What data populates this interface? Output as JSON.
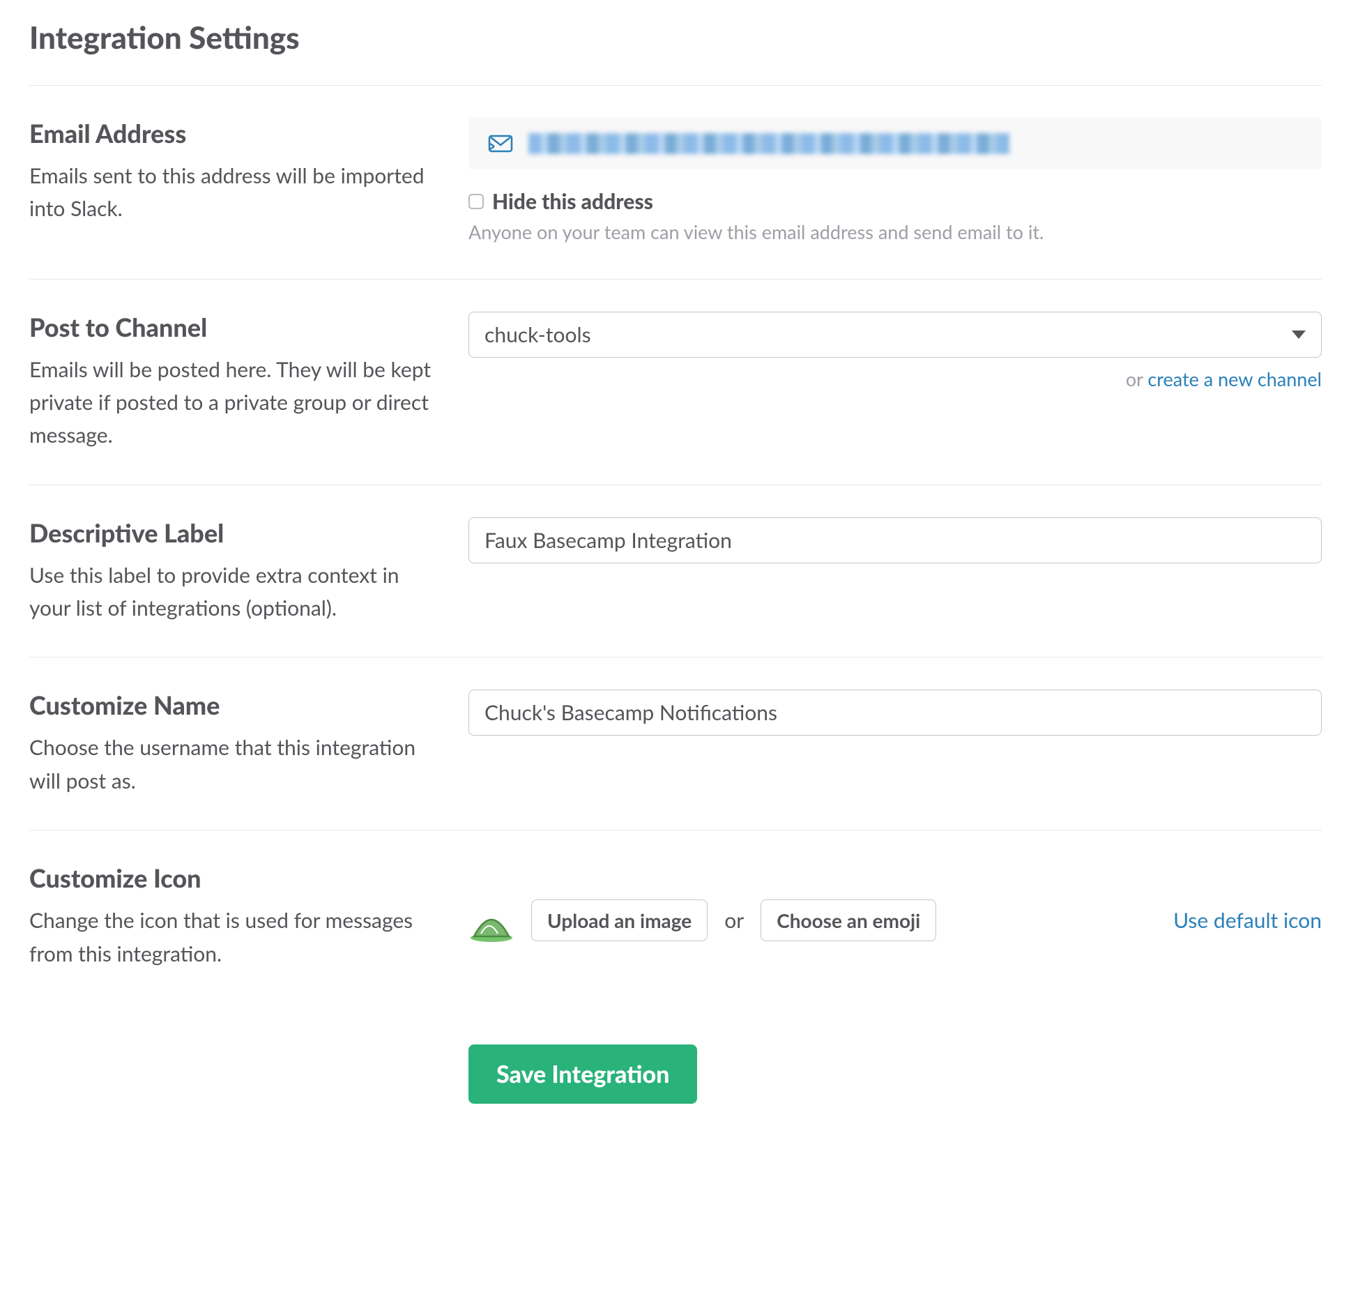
{
  "page_title": "Integration Settings",
  "sections": {
    "email": {
      "heading": "Email Address",
      "desc": "Emails sent to this address will be imported into Slack.",
      "hide_checkbox_label": "Hide this address",
      "hide_subtext": "Anyone on your team can view this email address and send email to it."
    },
    "channel": {
      "heading": "Post to Channel",
      "desc": "Emails will be posted here. They will be kept private if posted to a private group or direct message.",
      "selected": "chuck-tools",
      "helper_or": "or ",
      "helper_link": "create a new channel"
    },
    "label": {
      "heading": "Descriptive Label",
      "desc": "Use this label to provide extra context in your list of integrations (optional).",
      "value": "Faux Basecamp Integration"
    },
    "name": {
      "heading": "Customize Name",
      "desc": "Choose the username that this integration will post as.",
      "value": "Chuck's Basecamp Notifications"
    },
    "icon": {
      "heading": "Customize Icon",
      "desc": "Change the icon that is used for messages from this integration.",
      "upload_label": "Upload an image",
      "or_label": "or",
      "emoji_label": "Choose an emoji",
      "default_link": "Use default icon"
    }
  },
  "save_button": "Save Integration"
}
